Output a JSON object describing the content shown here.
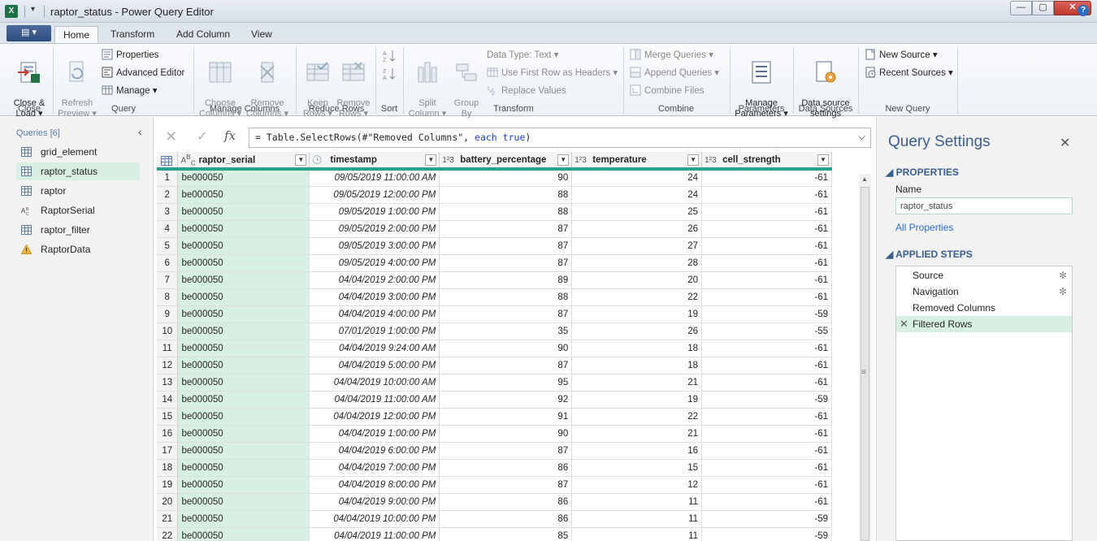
{
  "window": {
    "app_icon": "X",
    "title": "raptor_status - Power Query Editor",
    "quick_access_menu": "▾",
    "min_label": "—",
    "max_label": "▢",
    "close_label": "✕"
  },
  "ribbon_tabs": {
    "file": "▤ ▾",
    "home": "Home",
    "transform": "Transform",
    "add_column": "Add Column",
    "view": "View",
    "help": "?"
  },
  "ribbon": {
    "close_load": "Close &\nLoad ▾",
    "refresh_preview": "Refresh\nPreview ▾",
    "properties": "Properties",
    "advanced_editor": "Advanced Editor",
    "manage": "Manage ▾",
    "choose_columns": "Choose\nColumns ▾",
    "remove_columns": "Remove\nColumns ▾",
    "keep_rows": "Keep\nRows ▾",
    "remove_rows": "Remove\nRows ▾",
    "split_column": "Split\nColumn ▾",
    "group_by": "Group\nBy",
    "data_type": "Data Type: Text ▾",
    "use_first_row": "Use First Row as Headers ▾",
    "replace_values": "Replace Values",
    "merge_queries": "Merge Queries ▾",
    "append_queries": "Append Queries ▾",
    "combine_files": "Combine Files",
    "manage_parameters": "Manage\nParameters ▾",
    "data_source_settings": "Data source\nsettings",
    "new_source": "New Source ▾",
    "recent_sources": "Recent Sources ▾",
    "groups": {
      "close": "Close",
      "query": "Query",
      "manage_columns": "Manage Columns",
      "reduce_rows": "Reduce Rows",
      "sort": "Sort",
      "transform": "Transform",
      "combine": "Combine",
      "parameters": "Parameters",
      "data_sources": "Data Sources",
      "new_query": "New Query"
    }
  },
  "queries": {
    "header": "Queries [6]",
    "collapse": "‹",
    "items": [
      {
        "label": "grid_element",
        "icon": "table-icon"
      },
      {
        "label": "raptor_status",
        "icon": "table-icon",
        "selected": true
      },
      {
        "label": "raptor",
        "icon": "table-icon"
      },
      {
        "label": "RaptorSerial",
        "icon": "abc-text-icon"
      },
      {
        "label": "raptor_filter",
        "icon": "table-icon"
      },
      {
        "label": "RaptorData",
        "icon": "warning-icon"
      }
    ]
  },
  "formula_bar": {
    "cancel": "✕",
    "commit": "✓",
    "fx": "fx",
    "prefix": "= Table.SelectRows(#\"Removed Columns\", ",
    "keyword_each": "each",
    "keyword_true": "true",
    "suffix": ")",
    "expand": "⌵"
  },
  "grid": {
    "columns": [
      {
        "name": "raptor_serial",
        "type": "ABC"
      },
      {
        "name": "timestamp",
        "type": "clock"
      },
      {
        "name": "battery_percentage",
        "type": "123"
      },
      {
        "name": "temperature",
        "type": "123"
      },
      {
        "name": "cell_strength",
        "type": "123"
      }
    ],
    "rows": [
      [
        "1",
        "be000050",
        "09/05/2019 11:00:00 AM",
        "90",
        "24",
        "-61"
      ],
      [
        "2",
        "be000050",
        "09/05/2019 12:00:00 PM",
        "88",
        "24",
        "-61"
      ],
      [
        "3",
        "be000050",
        "09/05/2019 1:00:00 PM",
        "88",
        "25",
        "-61"
      ],
      [
        "4",
        "be000050",
        "09/05/2019 2:00:00 PM",
        "87",
        "26",
        "-61"
      ],
      [
        "5",
        "be000050",
        "09/05/2019 3:00:00 PM",
        "87",
        "27",
        "-61"
      ],
      [
        "6",
        "be000050",
        "09/05/2019 4:00:00 PM",
        "87",
        "28",
        "-61"
      ],
      [
        "7",
        "be000050",
        "04/04/2019 2:00:00 PM",
        "89",
        "20",
        "-61"
      ],
      [
        "8",
        "be000050",
        "04/04/2019 3:00:00 PM",
        "88",
        "22",
        "-61"
      ],
      [
        "9",
        "be000050",
        "04/04/2019 4:00:00 PM",
        "87",
        "19",
        "-59"
      ],
      [
        "10",
        "be000050",
        "07/01/2019 1:00:00 PM",
        "35",
        "26",
        "-55"
      ],
      [
        "11",
        "be000050",
        "04/04/2019 9:24:00 AM",
        "90",
        "18",
        "-61"
      ],
      [
        "12",
        "be000050",
        "04/04/2019 5:00:00 PM",
        "87",
        "18",
        "-61"
      ],
      [
        "13",
        "be000050",
        "04/04/2019 10:00:00 AM",
        "95",
        "21",
        "-61"
      ],
      [
        "14",
        "be000050",
        "04/04/2019 11:00:00 AM",
        "92",
        "19",
        "-59"
      ],
      [
        "15",
        "be000050",
        "04/04/2019 12:00:00 PM",
        "91",
        "22",
        "-61"
      ],
      [
        "16",
        "be000050",
        "04/04/2019 1:00:00 PM",
        "90",
        "21",
        "-61"
      ],
      [
        "17",
        "be000050",
        "04/04/2019 6:00:00 PM",
        "87",
        "16",
        "-61"
      ],
      [
        "18",
        "be000050",
        "04/04/2019 7:00:00 PM",
        "86",
        "15",
        "-61"
      ],
      [
        "19",
        "be000050",
        "04/04/2019 8:00:00 PM",
        "87",
        "12",
        "-61"
      ],
      [
        "20",
        "be000050",
        "04/04/2019 9:00:00 PM",
        "86",
        "11",
        "-61"
      ],
      [
        "21",
        "be000050",
        "04/04/2019 10:00:00 PM",
        "86",
        "11",
        "-59"
      ],
      [
        "22",
        "be000050",
        "04/04/2019 11:00:00 PM",
        "85",
        "11",
        "-59"
      ]
    ]
  },
  "query_settings": {
    "title": "Query Settings",
    "close": "✕",
    "properties_header": "PROPERTIES",
    "name_label": "Name",
    "name_value": "raptor_status",
    "all_properties": "All Properties",
    "applied_steps_header": "APPLIED STEPS",
    "steps": [
      {
        "label": "Source",
        "gear": true
      },
      {
        "label": "Navigation",
        "gear": true
      },
      {
        "label": "Removed Columns",
        "gear": false
      },
      {
        "label": "Filtered Rows",
        "gear": false,
        "selected": true
      }
    ]
  },
  "colors": {
    "accent_green": "#26a38a",
    "selection_green": "#d8f0e3",
    "header_blue": "#3b5e8a",
    "link_blue": "#2b6cc4",
    "excel_green": "#1e7145"
  }
}
